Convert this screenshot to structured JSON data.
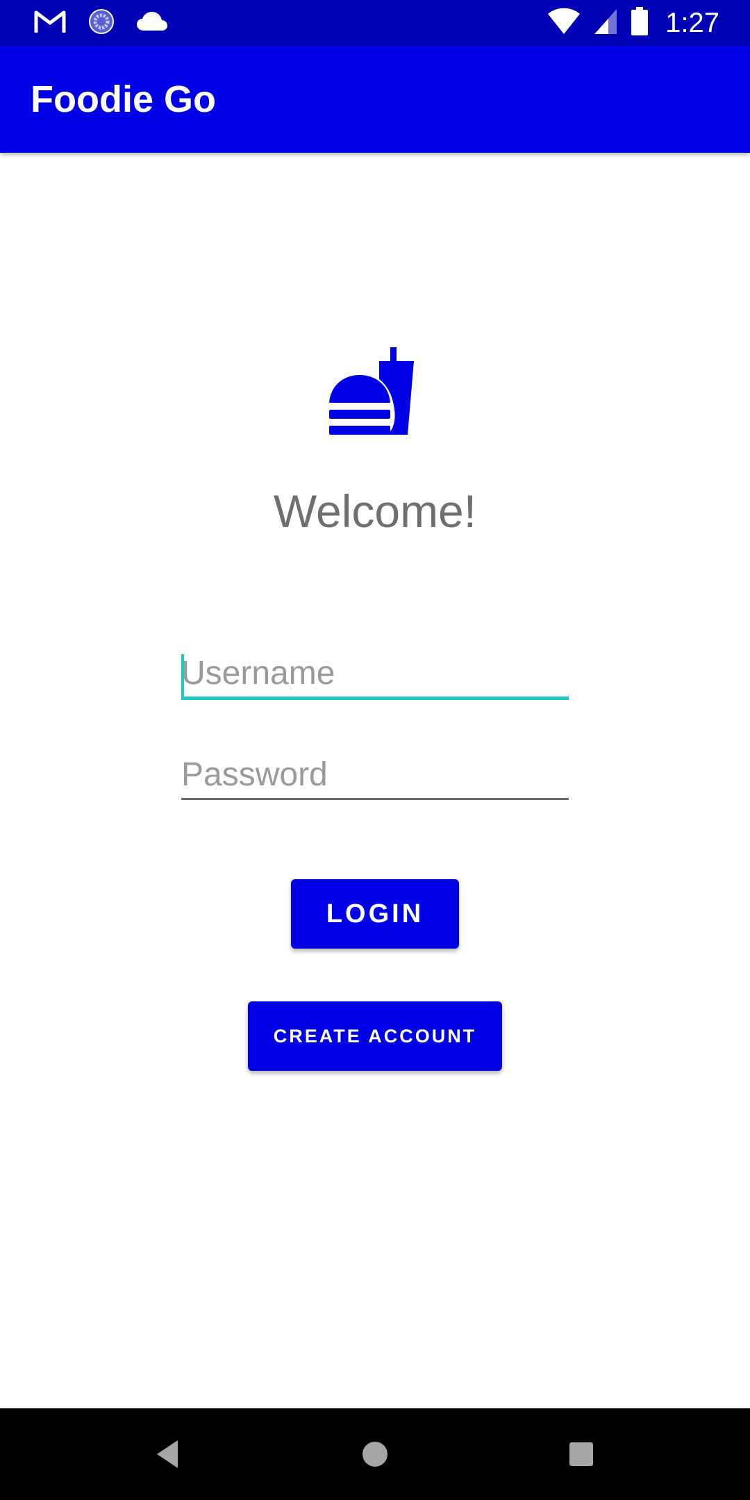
{
  "status_bar": {
    "time": "1:27",
    "left_icons": [
      "gmail-icon",
      "sync-progress-icon",
      "cloud-icon"
    ],
    "right_icons": [
      "wifi-icon",
      "cellular-signal-icon",
      "battery-icon"
    ]
  },
  "app_bar": {
    "title": "Foodie Go"
  },
  "main": {
    "logo_icon": "fastfood-icon",
    "welcome_text": "Welcome!",
    "username": {
      "placeholder": "Username",
      "value": ""
    },
    "password": {
      "placeholder": "Password",
      "value": ""
    },
    "login_label": "LOGIN",
    "create_account_label": "CREATE ACCOUNT"
  },
  "nav_bar": {
    "icons": [
      "back-icon",
      "home-icon",
      "recents-icon"
    ]
  },
  "colors": {
    "status_bar": "#0000b4",
    "primary": "#0000e6",
    "accent": "#1ecbc4",
    "welcome_text": "#6f6f6f",
    "hint_text": "#9a9a9a"
  }
}
